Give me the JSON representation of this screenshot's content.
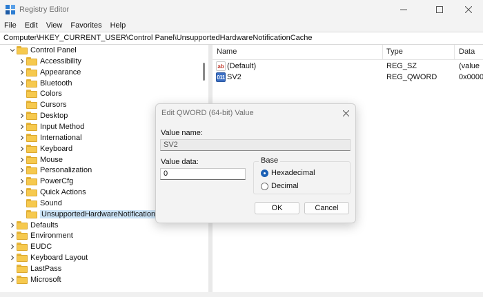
{
  "window": {
    "title": "Registry Editor",
    "icon": "registry-icon"
  },
  "menu": {
    "items": [
      "File",
      "Edit",
      "View",
      "Favorites",
      "Help"
    ]
  },
  "address": {
    "path": "Computer\\HKEY_CURRENT_USER\\Control Panel\\UnsupportedHardwareNotificationCache"
  },
  "tree": {
    "items": [
      {
        "label": "Control Panel",
        "expanded": true
      },
      {
        "label": "Accessibility"
      },
      {
        "label": "Appearance"
      },
      {
        "label": "Bluetooth"
      },
      {
        "label": "Colors"
      },
      {
        "label": "Cursors"
      },
      {
        "label": "Desktop"
      },
      {
        "label": "Input Method"
      },
      {
        "label": "International"
      },
      {
        "label": "Keyboard"
      },
      {
        "label": "Mouse"
      },
      {
        "label": "Personalization"
      },
      {
        "label": "PowerCfg"
      },
      {
        "label": "Quick Actions"
      },
      {
        "label": "Sound"
      },
      {
        "label": "UnsupportedHardwareNotificationCache",
        "selected": true
      },
      {
        "label": "Defaults"
      },
      {
        "label": "Environment"
      },
      {
        "label": "EUDC"
      },
      {
        "label": "Keyboard Layout"
      },
      {
        "label": "LastPass"
      },
      {
        "label": "Microsoft"
      }
    ]
  },
  "list": {
    "columns": [
      "Name",
      "Type",
      "Data"
    ],
    "rows": [
      {
        "icon": "string-value-icon",
        "glyph": "ab",
        "name": "(Default)",
        "type": "REG_SZ",
        "data": "(value"
      },
      {
        "icon": "binary-value-icon",
        "glyph": "011",
        "name": "SV2",
        "type": "REG_QWORD",
        "data": "0x0000"
      }
    ]
  },
  "dialog": {
    "title": "Edit QWORD (64-bit) Value",
    "value_name_label": "Value name:",
    "value_name": "SV2",
    "value_data_label": "Value data:",
    "value_data": "0",
    "base_label": "Base",
    "radio_hex": "Hexadecimal",
    "radio_dec": "Decimal",
    "selected_base": "Hexadecimal",
    "ok_label": "OK",
    "cancel_label": "Cancel"
  },
  "colors": {
    "accent": "#1a5fb4",
    "selection": "#cce4f7",
    "folder": "#f6c94e"
  }
}
